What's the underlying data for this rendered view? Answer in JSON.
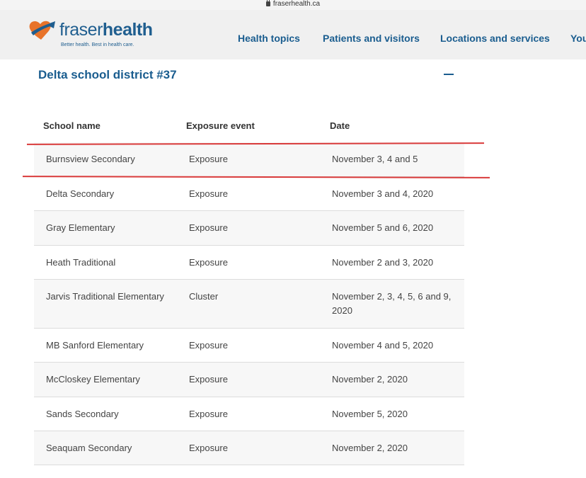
{
  "browser": {
    "url": "fraserhealth.ca"
  },
  "header": {
    "logo_light": "fraser",
    "logo_bold": "health",
    "tagline": "Better health. Best in health care.",
    "nav": [
      "Health topics",
      "Patients and visitors",
      "Locations and services",
      "You"
    ]
  },
  "section": {
    "title": "Delta school district #37"
  },
  "table": {
    "headers": [
      "School name",
      "Exposure event",
      "Date"
    ],
    "rows": [
      {
        "school": "Burnsview Secondary",
        "event": "Exposure",
        "date": "November 3, 4 and 5"
      },
      {
        "school": "Delta Secondary",
        "event": "Exposure",
        "date": "November 3 and 4, 2020"
      },
      {
        "school": "Gray Elementary",
        "event": "Exposure",
        "date": "November 5 and 6, 2020"
      },
      {
        "school": "Heath Traditional",
        "event": "Exposure",
        "date": "November 2 and 3, 2020"
      },
      {
        "school": "Jarvis Traditional Elementary",
        "event": "Cluster",
        "date": "November 2, 3, 4, 5, 6 and 9, 2020"
      },
      {
        "school": "MB Sanford Elementary",
        "event": "Exposure",
        "date": "November 4 and 5, 2020"
      },
      {
        "school": "McCloskey Elementary",
        "event": "Exposure",
        "date": "November 2, 2020"
      },
      {
        "school": "Sands Secondary",
        "event": "Exposure",
        "date": "November 5, 2020"
      },
      {
        "school": "Seaquam Secondary",
        "event": "Exposure",
        "date": "November 2, 2020"
      }
    ]
  },
  "colors": {
    "brand_blue": "#1a5d8f",
    "brand_orange": "#e8732a",
    "highlight_red": "#d93a3a"
  }
}
